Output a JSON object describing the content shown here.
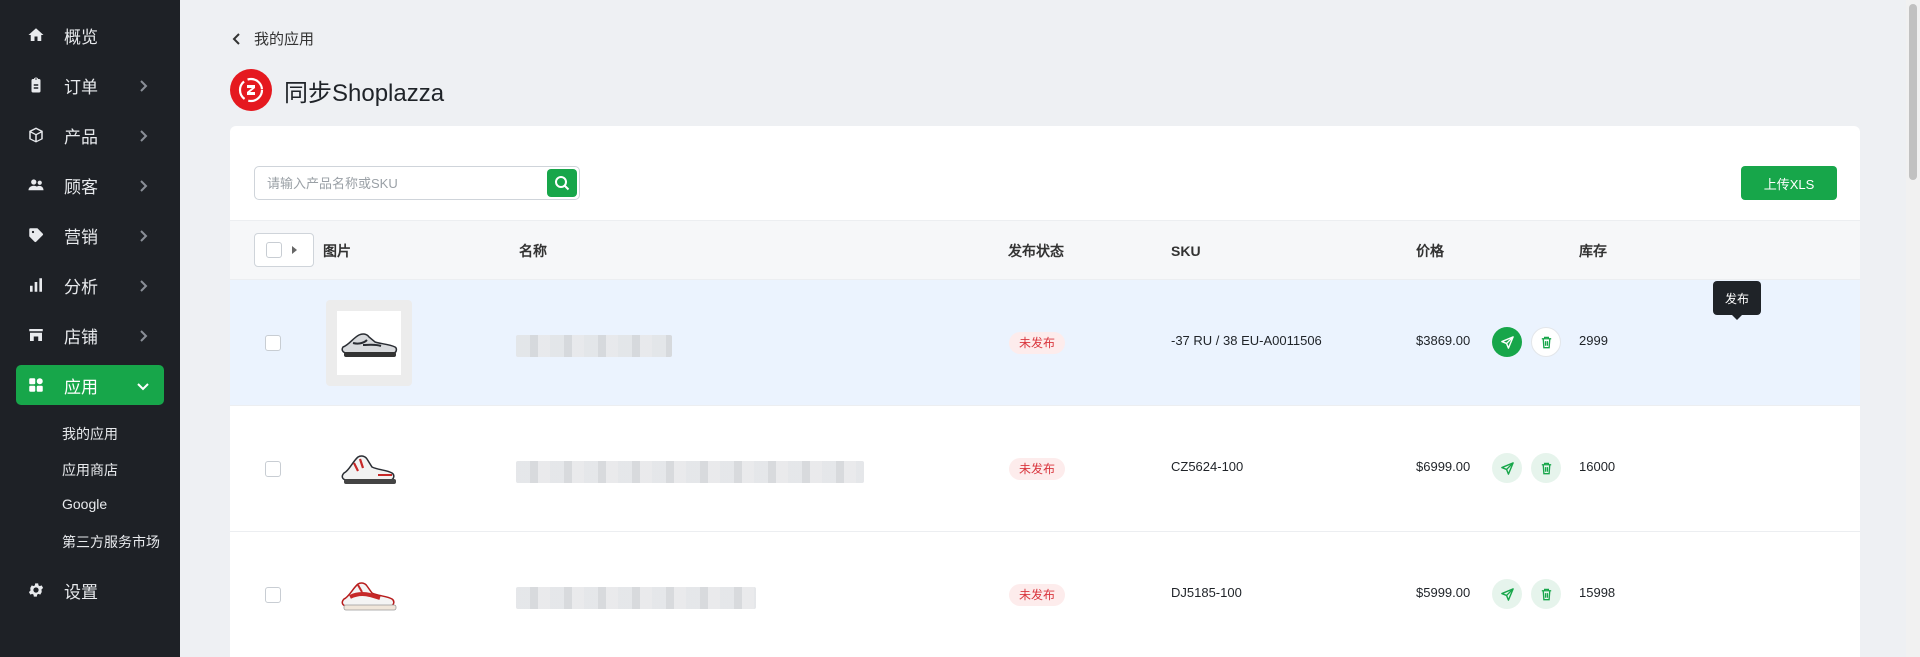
{
  "sidebar": {
    "items": [
      {
        "label": "概览",
        "icon": "home-icon"
      },
      {
        "label": "订单",
        "icon": "clipboard-icon"
      },
      {
        "label": "产品",
        "icon": "box-icon"
      },
      {
        "label": "顾客",
        "icon": "users-icon"
      },
      {
        "label": "营销",
        "icon": "tag-icon"
      },
      {
        "label": "分析",
        "icon": "bar-chart-icon"
      },
      {
        "label": "店铺",
        "icon": "store-icon"
      },
      {
        "label": "应用",
        "icon": "grid-icon"
      }
    ],
    "app_sub_items": [
      "我的应用",
      "应用商店",
      "Google",
      "第三方服务市场"
    ],
    "settings_label": "设置"
  },
  "header": {
    "back_label": "我的应用",
    "title": "同步Shoplazza"
  },
  "toolbar": {
    "search_placeholder": "请输入产品名称或SKU",
    "upload_label": "上传XLS"
  },
  "table": {
    "columns": [
      "图片",
      "名称",
      "发布状态",
      "SKU",
      "价格",
      "库存"
    ],
    "rows": [
      {
        "status": "未发布",
        "sku": "-37 RU / 38 EU-A0011506",
        "price": "$3869.00",
        "stock": "2999"
      },
      {
        "status": "未发布",
        "sku": "CZ5624-100",
        "price": "$6999.00",
        "stock": "16000"
      },
      {
        "status": "未发布",
        "sku": "DJ5185-100",
        "price": "$5999.00",
        "stock": "15998"
      }
    ]
  },
  "tooltip": "发布",
  "colors": {
    "accent": "#17a64a",
    "sidebar_bg": "#1e2126",
    "danger": "#d9363e"
  }
}
